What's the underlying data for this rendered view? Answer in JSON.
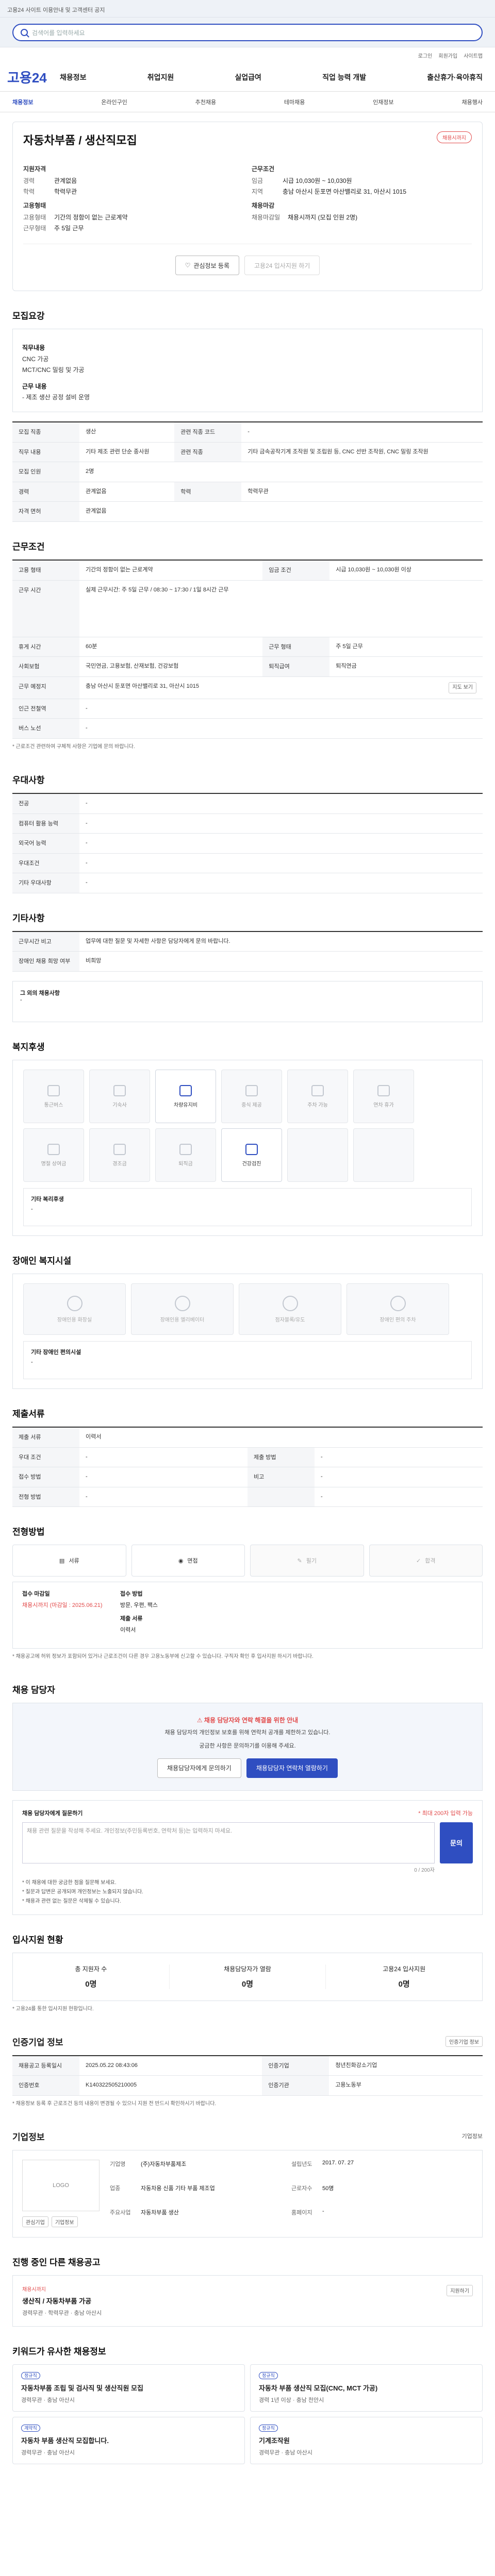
{
  "top_notice": "고용24 사이트 이용안내 및 고객센터 공지",
  "search": {
    "placeholder": "검색어를 입력하세요"
  },
  "util": {
    "login": "로그인",
    "join": "회원가입",
    "sitemap": "사이트맵"
  },
  "gnb": {
    "logo": "고용24",
    "menu": [
      "채용정보",
      "취업지원",
      "실업급여",
      "직업 능력 개발",
      "출산휴가·육아휴직"
    ]
  },
  "subnav": [
    "채용정보",
    "온라인구인",
    "추천채용",
    "테마채용",
    "인재정보",
    "채용행사"
  ],
  "job": {
    "badge": "채용시까지",
    "title": "자동차부품 / 생산직모집",
    "left_sub": "지원자격",
    "left": [
      {
        "k": "경력",
        "v": "관계없음"
      },
      {
        "k": "학력",
        "v": "학력무관"
      }
    ],
    "right_sub": "근무조건",
    "right": [
      {
        "k": "임금",
        "v": "시급 10,030원 ~ 10,030원"
      },
      {
        "k": "지역",
        "v": "충남 아산시 둔포면 아산밸리로 31, 아산시 1015"
      }
    ],
    "left2_sub": "고용형태",
    "left2": [
      {
        "k": "고용형태",
        "v": "기간의 정함이 없는 근로계약"
      },
      {
        "k": "근무형태",
        "v": "주 5일 근무"
      }
    ],
    "right2_sub": "채용마감",
    "right2": [
      {
        "k": "채용마감일",
        "v": "채용시까지 (모집 인원 2명)"
      }
    ],
    "btn_fav": "관심정보 등록",
    "btn_apply": "고용24 입사지원 하기"
  },
  "sections": {
    "recruit": "모집요강",
    "condition": "근무조건",
    "welfare": "복지후생",
    "benefit": "우대사항",
    "other": "기타사항",
    "disabled": "장애인 복지시설",
    "doc": "제출서류",
    "apply": "전형방법",
    "contact": "채용 담당자",
    "stats": "입사지원 현황",
    "post": "인증기업 정보",
    "company": "기업정보",
    "similar": "진행 중인 다른 채용공고",
    "recommend": "키워드가 유사한 채용정보"
  },
  "recruit_desc": {
    "l1": "직무내용",
    "v1": "CNC 가공",
    "v2": "MCT/CNC 밀링 및 가공",
    "l2": "근무 내용",
    "v3": "- 제조 생산 공정 설비 운영"
  },
  "recruit_table": [
    {
      "k": "모집 직종",
      "v": "생산",
      "k2": "관련 직종 코드",
      "v2": "-"
    },
    {
      "k": "직무 내용",
      "v": "기타 제조 관련 단순 종사원",
      "k2": "관련 직종",
      "v2": "기타 금속공작기계 조작원 및 조립원 등, CNC 선반 조작원, CNC 밀링 조작원"
    },
    {
      "k": "모집 인원",
      "v": "2명",
      "k2": "",
      "v2": ""
    },
    {
      "k": "경력",
      "v": "관계없음",
      "k2": "학력",
      "v2": "학력무관"
    },
    {
      "k": "자격 면허",
      "v": "관계없음",
      "k2": "",
      "v2": ""
    }
  ],
  "cond_table": [
    {
      "k": "고용 형태",
      "v": "기간의 정함이 없는 근로계약",
      "k2": "임금 조건",
      "v2": "시급 10,030원 ~ 10,030원 이상"
    },
    {
      "k": "근무 시간",
      "v": "실제 근무시간: 주 5일 근무 / 08:30 ~ 17:30 / 1일 8시간 근무",
      "k2": "",
      "v2": ""
    },
    {
      "k": "휴게 시간",
      "v": "60분",
      "k2": "근무 형태",
      "v2": "주 5일 근무"
    },
    {
      "k": "사회보험",
      "v": "국민연금, 고용보험, 산재보험, 건강보험",
      "k2": "퇴직급여",
      "v2": "퇴직연금"
    },
    {
      "k": "근무 예정지",
      "v": "충남 아산시 둔포면 아산밸리로 31, 아산시 1015",
      "k2": "",
      "v2": ""
    },
    {
      "k": "인근 전철역",
      "v": "-",
      "k2": "",
      "v2": ""
    },
    {
      "k": "버스 노선",
      "v": "-",
      "k2": "",
      "v2": ""
    }
  ],
  "map_btn": "지도 보기",
  "cond_note": "* 근로조건 관련하여 구체적 사항은 기업에 문의 바랍니다.",
  "benefit_table": [
    {
      "k": "전공",
      "v": "-"
    },
    {
      "k": "컴퓨터 활용 능력",
      "v": "-"
    },
    {
      "k": "외국어 능력",
      "v": "-"
    },
    {
      "k": "우대조건",
      "v": "-"
    },
    {
      "k": "기타 우대사항",
      "v": "-"
    }
  ],
  "other_table": [
    {
      "k": "근무시간 비고",
      "v": "업무에 대한 질문 및 자세한 사항은 담당자에게 문의 바랍니다."
    },
    {
      "k": "장애인 채용 희망 여부",
      "v": "비희망"
    }
  ],
  "welfare_items": [
    {
      "name": "통근버스",
      "on": false
    },
    {
      "name": "기숙사",
      "on": false
    },
    {
      "name": "차량유지비",
      "on": true
    },
    {
      "name": "중식 제공",
      "on": false
    },
    {
      "name": "주차 가능",
      "on": false
    },
    {
      "name": "연차 휴가",
      "on": false
    },
    {
      "name": "명절 상여금",
      "on": false
    },
    {
      "name": "경조금",
      "on": false
    },
    {
      "name": "퇴직금",
      "on": false
    },
    {
      "name": "건강검진",
      "on": true
    },
    {
      "name": "",
      "on": false
    },
    {
      "name": "",
      "on": false
    }
  ],
  "welfare_etc": {
    "label": "기타 복리후생",
    "value": "-"
  },
  "disabled_items": [
    "장애인용 화장실",
    "장애인용 엘리베이터",
    "점자블록/유도",
    "장애인 편의 주차"
  ],
  "disabled_etc": {
    "label": "기타 장애인 편의시설",
    "value": "-"
  },
  "doc_table": [
    {
      "k": "제출 서류",
      "v": "이력서",
      "k2": "",
      "v2": ""
    },
    {
      "k": "우대 조건",
      "v": "-",
      "k2": "제출 방법",
      "v2": "-"
    },
    {
      "k": "접수 방법",
      "v": "-",
      "k2": "비고",
      "v2": "-"
    },
    {
      "k": "전형 방법",
      "v": "-",
      "k2": "",
      "v2": "-"
    }
  ],
  "apply_steps": [
    "서류",
    "면접",
    "필기",
    "합격"
  ],
  "apply_detail": {
    "t1": "접수 마감일",
    "v1": "채용시까지 (마감일 : 2025.06.21)",
    "t2": "접수 방법",
    "v2": "방문, 우편, 팩스",
    "t3": "제출 서류",
    "v3": "이력서",
    "notes": "* 채용공고에 허위 정보가 포함되어 있거나 근로조건이 다른 경우 고용노동부에 신고할 수 있습니다. 구직자 확인 후 입사지원 하시기 바랍니다."
  },
  "contact": {
    "alert": "채용 담당자와 연락 해결을 위한 안내",
    "p1": "채용 담당자의 개인정보 보호를 위해 연락처 공개를 제한하고 있습니다.",
    "p2": "궁금한 사항은 문의하기를 이용해 주세요.",
    "btn1": "채용담당자에게 문의하기",
    "btn2": "채용담당자 연락처 열람하기"
  },
  "qform": {
    "title": "채용 담당자에게 질문하기",
    "limit": "* 최대 200자 입력 가능",
    "placeholder": "채용 관련 질문을 작성해 주세요. 개인정보(주민등록번호, 연락처 등)는 입력하지 마세요.",
    "count": "0 / 200자",
    "submit": "문의",
    "n1": "* 이 채용에 대한 궁금한 점을 질문해 보세요.",
    "n2": "* 질문과 답변은 공개되며 개인정보는 노출되지 않습니다.",
    "n3": "* 채용과 관련 없는 질문은 삭제될 수 있습니다."
  },
  "stats": [
    {
      "label": "총 지원자 수",
      "value": "0명"
    },
    {
      "label": "채용담당자가 열람",
      "value": "0명"
    },
    {
      "label": "고용24 입사지원",
      "value": "0명"
    }
  ],
  "stats_note": "* 고용24를 통한 입사지원 현황입니다.",
  "post": {
    "btn": "인증기업 정보",
    "rows": [
      {
        "k": "채용공고 등록일시",
        "v": "2025.05.22 08:43:06",
        "k2": "인증기업",
        "v2": "청년친화강소기업"
      },
      {
        "k": "인증번호",
        "v": "K140322505210005",
        "k2": "인증기관",
        "v2": "고용노동부"
      }
    ],
    "note": "* 채용정보 등록 후 근로조건 등의 내용이 변경될 수 있으니 지원 전 반드시 확인하시기 바랍니다."
  },
  "company": {
    "more": "기업정보",
    "logo": "LOGO",
    "btn1": "관심기업",
    "btn2": "기업정보",
    "rows": [
      {
        "k": "기업명",
        "v": "(주)자동차부품제조",
        "k2": "설립년도",
        "v2": "2017. 07. 27"
      },
      {
        "k": "업종",
        "v": "자동차용 신품 기타 부품 제조업",
        "k2": "근로자수",
        "v2": "50명"
      },
      {
        "k": "주요사업",
        "v": "자동차부품 생산",
        "k2": "홈페이지",
        "v2": "-"
      }
    ]
  },
  "similar": {
    "tag": "채용시까지",
    "title": "생산직 / 자동차부품 가공",
    "meta": "경력무관 · 학력무관 · 충남 아산시",
    "btn": "지원하기"
  },
  "recommend": [
    {
      "tag": "정규직",
      "title": "자동차부품 조립 및 검사직 및 생산직원 모집",
      "meta": "경력무관 · 충남 아산시"
    },
    {
      "tag": "정규직",
      "title": "자동차 부품 생산직 모집(CNC, MCT 가공)",
      "meta": "경력 1년 이상 · 충남 천안시"
    },
    {
      "tag": "계약직",
      "title": "자동차 부품 생산직 모집합니다.",
      "meta": "경력무관 · 충남 아산시"
    },
    {
      "tag": "정규직",
      "title": "기계조작원",
      "meta": "경력무관 · 충남 아산시"
    }
  ]
}
